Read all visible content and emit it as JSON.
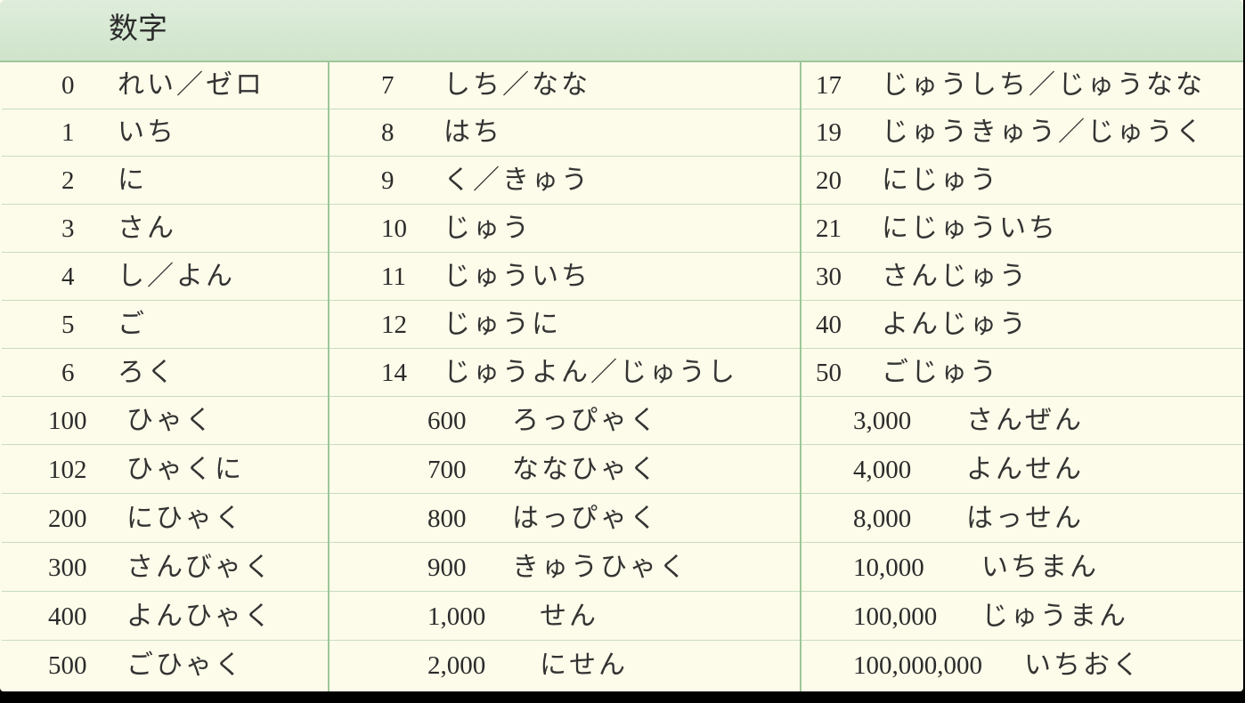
{
  "header": {
    "title": "数字"
  },
  "colors": {
    "header_bg": "#d6e9d2",
    "border": "#9dc79a",
    "cell_bg": "#fdfbe9",
    "text": "#2b2b2b"
  },
  "columns": [
    [
      {
        "num": "0",
        "word": "れい／ゼロ"
      },
      {
        "num": "1",
        "word": "いち"
      },
      {
        "num": "2",
        "word": "に"
      },
      {
        "num": "3",
        "word": "さん"
      },
      {
        "num": "4",
        "word": "し／よん"
      },
      {
        "num": "5",
        "word": "ご"
      },
      {
        "num": "6",
        "word": "ろく"
      },
      {
        "num": "100",
        "word": "ひゃく"
      },
      {
        "num": "102",
        "word": "ひゃくに"
      },
      {
        "num": "200",
        "word": "にひゃく"
      },
      {
        "num": "300",
        "word": "さんびゃく"
      },
      {
        "num": "400",
        "word": "よんひゃく"
      },
      {
        "num": "500",
        "word": "ごひゃく"
      }
    ],
    [
      {
        "num": "7",
        "word": "しち／なな"
      },
      {
        "num": "8",
        "word": "はち"
      },
      {
        "num": "9",
        "word": "く／きゅう"
      },
      {
        "num": "10",
        "word": "じゅう"
      },
      {
        "num": "11",
        "word": "じゅういち"
      },
      {
        "num": "12",
        "word": "じゅうに"
      },
      {
        "num": "14",
        "word": "じゅうよん／じゅうし"
      },
      {
        "num": "600",
        "word": "ろっぴゃく"
      },
      {
        "num": "700",
        "word": "ななひゃく"
      },
      {
        "num": "800",
        "word": "はっぴゃく"
      },
      {
        "num": "900",
        "word": "きゅうひゃく"
      },
      {
        "num": "1,000",
        "word": "せん"
      },
      {
        "num": "2,000",
        "word": "にせん"
      }
    ],
    [
      {
        "num": "17",
        "word": "じゅうしち／じゅうなな"
      },
      {
        "num": "19",
        "word": "じゅうきゅう／じゅうく"
      },
      {
        "num": "20",
        "word": "にじゅう"
      },
      {
        "num": "21",
        "word": "にじゅういち"
      },
      {
        "num": "30",
        "word": "さんじゅう"
      },
      {
        "num": "40",
        "word": "よんじゅう"
      },
      {
        "num": "50",
        "word": "ごじゅう"
      },
      {
        "num": "3,000",
        "word": "さんぜん"
      },
      {
        "num": "4,000",
        "word": "よんせん"
      },
      {
        "num": "8,000",
        "word": "はっせん"
      },
      {
        "num": "10,000",
        "word": "いちまん"
      },
      {
        "num": "100,000",
        "word": "じゅうまん"
      },
      {
        "num": "100,000,000",
        "word": "いちおく"
      }
    ]
  ]
}
